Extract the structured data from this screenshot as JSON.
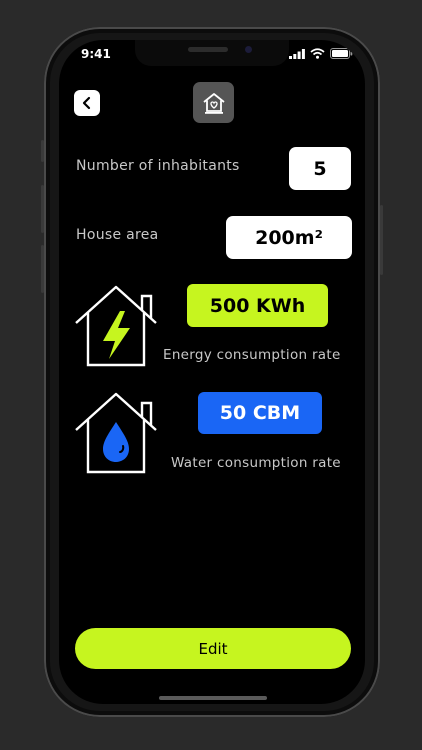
{
  "status_bar": {
    "time": "9:41"
  },
  "header": {
    "back_icon": "chevron-left-icon",
    "logo_icon": "house-heart-icon"
  },
  "inhabitants": {
    "label": "Number of inhabitants",
    "value": "5"
  },
  "house_area": {
    "label": "House area",
    "value": "200m²"
  },
  "energy": {
    "value": "500 KWh",
    "label": "Energy consumption rate",
    "color": "#c6f51f",
    "icon": "house-lightning-icon"
  },
  "water": {
    "value": "50 CBM",
    "label": "Water consumption rate",
    "color": "#1a66f5",
    "icon": "house-water-drop-icon"
  },
  "actions": {
    "edit_label": "Edit",
    "accent": "#c6f51f"
  }
}
